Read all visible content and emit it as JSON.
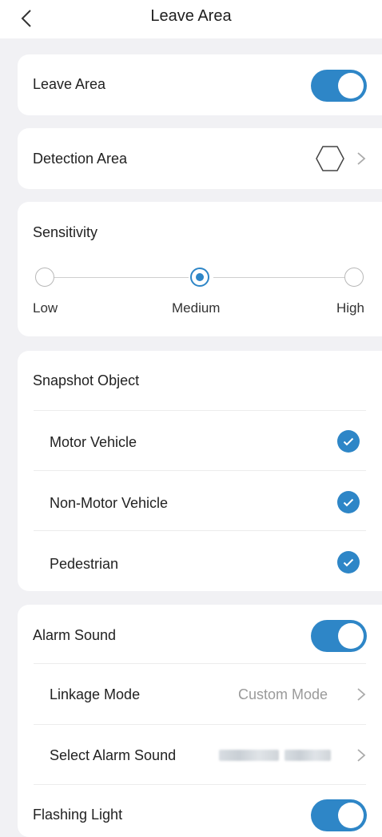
{
  "header": {
    "title": "Leave Area",
    "back_icon": "chevron-left-icon"
  },
  "leave_area": {
    "label": "Leave Area",
    "enabled": true
  },
  "detection_area": {
    "label": "Detection Area",
    "icon": "hexagon-icon"
  },
  "sensitivity": {
    "label": "Sensitivity",
    "levels": [
      "Low",
      "Medium",
      "High"
    ],
    "selected": "Medium"
  },
  "snapshot": {
    "label": "Snapshot Object",
    "items": [
      {
        "label": "Motor Vehicle",
        "checked": true
      },
      {
        "label": "Non-Motor Vehicle",
        "checked": true
      },
      {
        "label": "Pedestrian",
        "checked": true
      }
    ]
  },
  "alarm": {
    "sound_label": "Alarm Sound",
    "sound_enabled": true,
    "linkage_label": "Linkage Mode",
    "linkage_value": "Custom Mode",
    "select_sound_label": "Select Alarm Sound",
    "flashing_label": "Flashing Light",
    "flashing_enabled": true
  },
  "colors": {
    "accent": "#2e86c7",
    "background": "#f1f1f4",
    "card": "#ffffff"
  }
}
